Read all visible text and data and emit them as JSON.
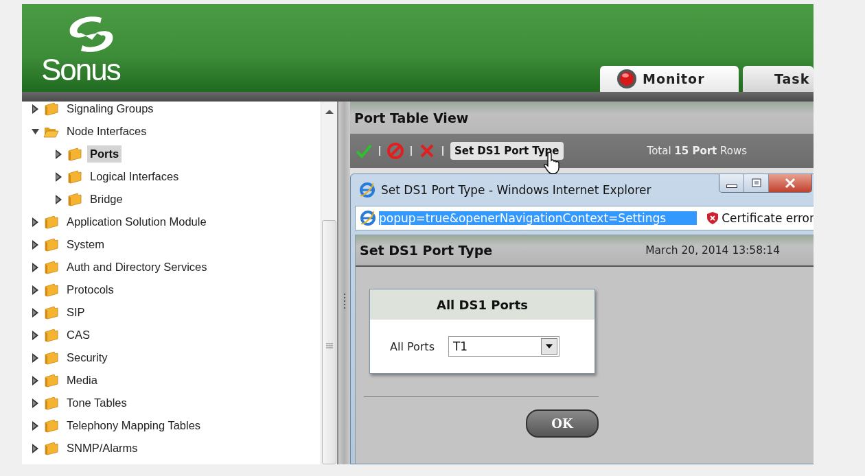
{
  "app": {
    "logo": "Sonus",
    "tabs": [
      {
        "label": "Monitor",
        "selected": true,
        "kind": "record"
      },
      {
        "label": "Task",
        "selected": false,
        "kind": "plain"
      }
    ]
  },
  "tree": {
    "items": [
      {
        "label": "Signaling Groups",
        "expanded": false,
        "selected": false
      },
      {
        "label": "Node Interfaces",
        "expanded": true,
        "selected": false,
        "children": [
          {
            "label": "Ports",
            "expanded": false,
            "selected": true
          },
          {
            "label": "Logical Interfaces",
            "expanded": false,
            "selected": false
          },
          {
            "label": "Bridge",
            "expanded": false,
            "selected": false
          }
        ]
      },
      {
        "label": "Application Solution Module",
        "expanded": false,
        "selected": false
      },
      {
        "label": "System",
        "expanded": false,
        "selected": false
      },
      {
        "label": "Auth and Directory Services",
        "expanded": false,
        "selected": false
      },
      {
        "label": "Protocols",
        "expanded": false,
        "selected": false
      },
      {
        "label": "SIP",
        "expanded": false,
        "selected": false
      },
      {
        "label": "CAS",
        "expanded": false,
        "selected": false
      },
      {
        "label": "Security",
        "expanded": false,
        "selected": false
      },
      {
        "label": "Media",
        "expanded": false,
        "selected": false
      },
      {
        "label": "Tone Tables",
        "expanded": false,
        "selected": false
      },
      {
        "label": "Telephony Mapping Tables",
        "expanded": false,
        "selected": false
      },
      {
        "label": "SNMP/Alarms",
        "expanded": false,
        "selected": false
      }
    ]
  },
  "panel": {
    "title": "Port Table View",
    "toolbar": {
      "button": "Set DS1 Port Type",
      "total": "Total **15 Port** Rows"
    }
  },
  "popup": {
    "title": "Set DS1 Port Type - Windows Internet Explorer",
    "address": "popup=true&openerNavigationContext=Settings",
    "address_selected": true,
    "address_status": "Certificate error",
    "page_title": "Set DS1 Port Type",
    "timestamp": "March 20, 2014 13:58:14",
    "group": {
      "title": "All DS1 Ports",
      "fields": [
        {
          "label": "All Ports",
          "value": "T1"
        }
      ]
    },
    "ok": "OK"
  }
}
